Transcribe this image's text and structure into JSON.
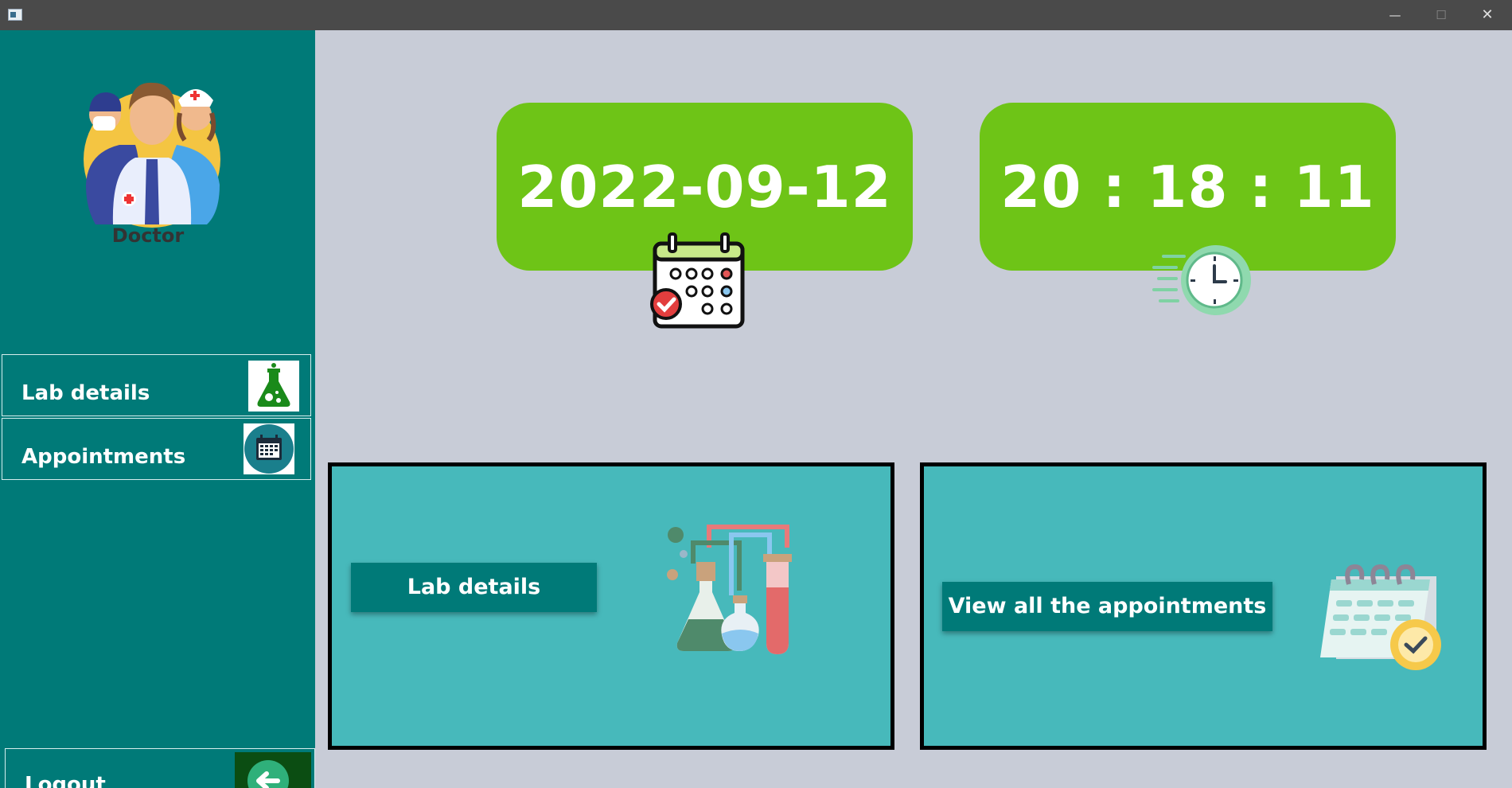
{
  "window": {
    "minimize_glyph": "—",
    "maximize_glyph": "☐",
    "close_glyph": "✕"
  },
  "sidebar": {
    "role": "Doctor",
    "items": [
      {
        "label": "Lab details",
        "icon": "flask-icon"
      },
      {
        "label": "Appointments",
        "icon": "calendar-icon"
      }
    ],
    "logout": {
      "label": "Logout",
      "icon": "arrow-left-icon"
    }
  },
  "dashboard": {
    "date": "2022-09-12",
    "time": "20 : 18 : 11",
    "date_icon": "calendar-check-icon",
    "time_icon": "fast-clock-icon"
  },
  "panels": {
    "lab": {
      "button_label": "Lab details",
      "illustration": "lab-equipment-illustration"
    },
    "appointments": {
      "button_label": "View all the appointments",
      "illustration": "calendar-clock-illustration"
    }
  },
  "colors": {
    "sidebar": "#007a78",
    "card_green": "#6ec417",
    "panel_teal": "#47b9bb",
    "background": "#c8ccd7"
  }
}
